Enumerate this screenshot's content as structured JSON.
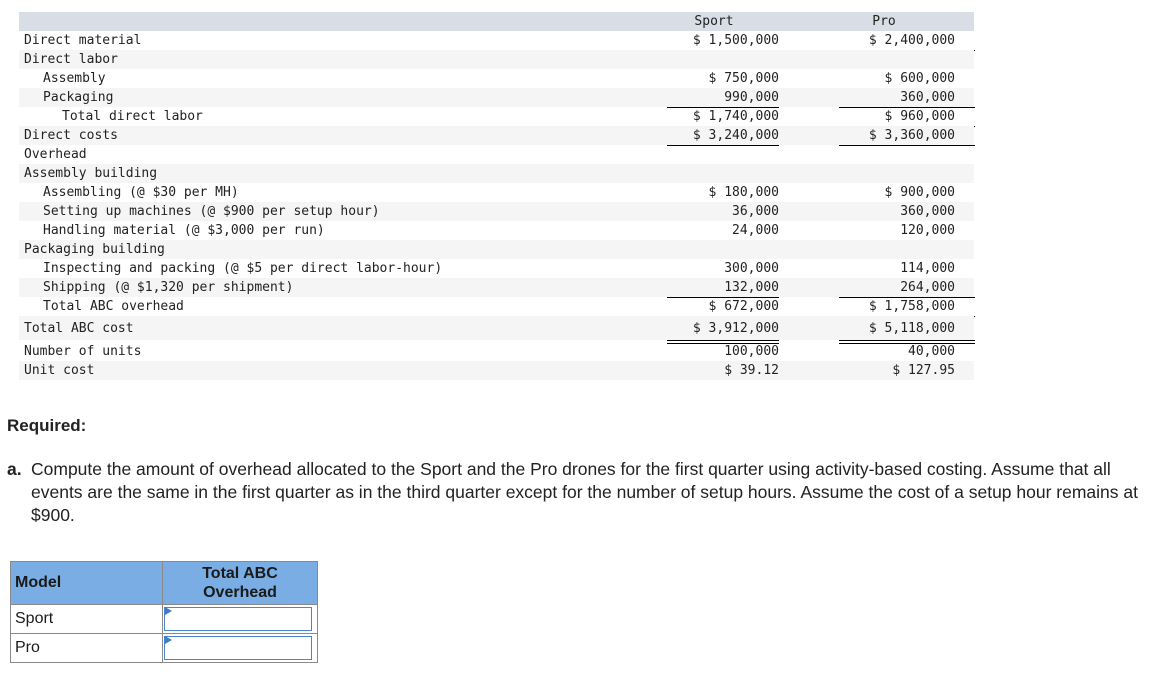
{
  "table": {
    "headers": [
      "Sport",
      "Pro"
    ],
    "rows": [
      {
        "label": "Direct material",
        "sport": "$ 1,500,000",
        "pro": "$ 2,400,000"
      },
      {
        "label": "Direct labor",
        "sport": "",
        "pro": ""
      },
      {
        "label": "Assembly",
        "sport": "$ 750,000",
        "pro": "$ 600,000"
      },
      {
        "label": "Packaging",
        "sport": "990,000",
        "pro": "360,000"
      },
      {
        "label": "Total direct labor",
        "sport": "$ 1,740,000",
        "pro": "$ 960,000"
      },
      {
        "label": "Direct costs",
        "sport": "$ 3,240,000",
        "pro": "$ 3,360,000"
      },
      {
        "label": "Overhead",
        "sport": "",
        "pro": ""
      },
      {
        "label": "Assembly building",
        "sport": "",
        "pro": ""
      },
      {
        "label": "Assembling (@ $30 per MH)",
        "sport": "$ 180,000",
        "pro": "$ 900,000"
      },
      {
        "label": "Setting up machines (@ $900 per setup hour)",
        "sport": "36,000",
        "pro": "360,000"
      },
      {
        "label": "Handling material (@ $3,000 per run)",
        "sport": "24,000",
        "pro": "120,000"
      },
      {
        "label": "Packaging building",
        "sport": "",
        "pro": ""
      },
      {
        "label": "Inspecting and packing (@ $5 per direct labor-hour)",
        "sport": "300,000",
        "pro": "114,000"
      },
      {
        "label": "Shipping (@ $1,320 per shipment)",
        "sport": "132,000",
        "pro": "264,000"
      },
      {
        "label": "Total ABC overhead",
        "sport": "$ 672,000",
        "pro": "$ 1,758,000"
      },
      {
        "label": "Total ABC cost",
        "sport": "$ 3,912,000",
        "pro": "$ 5,118,000"
      },
      {
        "label": "Number of units",
        "sport": "100,000",
        "pro": "40,000"
      },
      {
        "label": "Unit cost",
        "sport": "$ 39.12",
        "pro": "$ 127.95"
      }
    ]
  },
  "required": {
    "heading": "Required:",
    "part_letter": "a.",
    "part_text": "Compute the amount of overhead allocated to the Sport and the Pro drones for the first quarter using activity-based costing. Assume that all events are the same in the first quarter as in the third quarter except for the number of setup hours. Assume the cost of a setup hour remains at $900."
  },
  "answer_table": {
    "col_model": "Model",
    "col_total": "Total ABC Overhead",
    "rows": [
      {
        "model": "Sport",
        "value": ""
      },
      {
        "model": "Pro",
        "value": ""
      }
    ]
  }
}
